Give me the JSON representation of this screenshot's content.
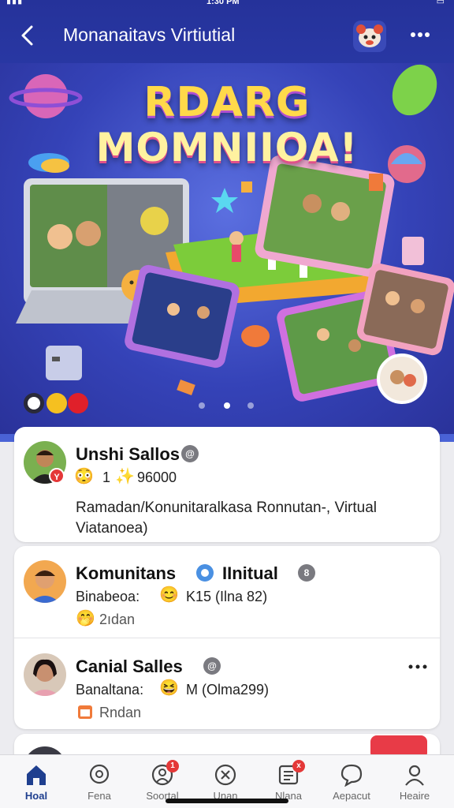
{
  "status_bar": {
    "time": "1:30 PM"
  },
  "app_bar": {
    "title": "Monanaitavs Virtiutial"
  },
  "hero": {
    "title_line_1": "RDARG",
    "title_line_2": "MOMNIIOA!",
    "slide_count": 3,
    "active_slide": 2
  },
  "posts": [
    {
      "name": "Unshi Sallos",
      "verified_badge": "@",
      "stats_count": "1",
      "stats_points": "96000",
      "text": "Ramadan/Konunitaralkasa Ronnutan-, Virtual Viatanoea)",
      "avatar_badge": "Y"
    },
    {
      "name": "Komunitans",
      "name_suffix": "IInitual",
      "verified_badge": "8",
      "sub_label": "Binabeoa:",
      "sub_value": "K15 (Ilna 82)",
      "footer_text": "2ıdan"
    },
    {
      "name": "Canial Salles",
      "verified_badge": "@",
      "sub_label": "Banaltana:",
      "sub_value": "M (Olma299)",
      "footer_text": "Rndan"
    }
  ],
  "bottom_nav": {
    "items": [
      {
        "label": "Hoal",
        "icon": "home-icon",
        "active": true
      },
      {
        "label": "Fena",
        "icon": "search-icon",
        "active": false
      },
      {
        "label": "Soortal",
        "icon": "people-icon",
        "active": false,
        "badge": "1"
      },
      {
        "label": "Unan",
        "icon": "close-circle-icon",
        "active": false
      },
      {
        "label": "Nlana",
        "icon": "list-icon",
        "active": false,
        "badge": "x"
      },
      {
        "label": "Aepacut",
        "icon": "chat-icon",
        "active": false
      },
      {
        "label": "Heaire",
        "icon": "profile-icon",
        "active": false
      }
    ]
  },
  "colors": {
    "header_bg": "#2e3fb0",
    "active_nav": "#1f3f8f",
    "accent_red": "#e43838"
  }
}
